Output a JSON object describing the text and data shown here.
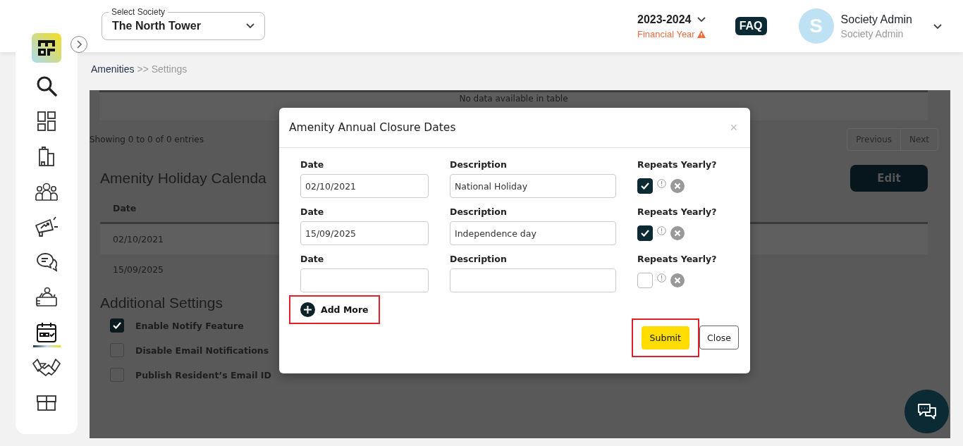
{
  "header": {
    "society_select": {
      "label": "Select Society",
      "value": "The North Tower"
    },
    "financial_year": {
      "value": "2023-2024",
      "label": "Financial Year"
    },
    "faq": "FAQ",
    "user": {
      "initial": "S",
      "name": "Society Admin",
      "role": "Society Admin"
    }
  },
  "sidebar": {
    "items": [
      {
        "kind": "search",
        "selected": false
      },
      {
        "kind": "dashboard",
        "selected": false
      },
      {
        "kind": "building",
        "selected": false
      },
      {
        "kind": "people",
        "selected": false
      },
      {
        "kind": "megaphone",
        "selected": false
      },
      {
        "kind": "chat",
        "selected": false
      },
      {
        "kind": "desk",
        "selected": false
      },
      {
        "kind": "calendar",
        "selected": true
      },
      {
        "kind": "handshake",
        "selected": false
      },
      {
        "kind": "box",
        "selected": false
      }
    ]
  },
  "breadcrumb": [
    {
      "label": "Amenities",
      "current": false
    },
    {
      "label": ">> Settings",
      "current": true
    }
  ],
  "closures_table": {
    "empty_text": "No data available in table",
    "info": "Showing 0 to 0 of 0 entries",
    "pagination": [
      "Previous",
      "Next"
    ]
  },
  "holiday_calendar": {
    "title": "Amenity Holiday Calenda",
    "edit_button": "Edit",
    "columns": [
      "Date"
    ],
    "rows": [
      "02/10/2021",
      "15/09/2025"
    ]
  },
  "additional_settings": {
    "title": "Additional Settings",
    "options": [
      {
        "label": "Enable Notify Feature",
        "checked": true
      },
      {
        "label": "Disable Email Notifications",
        "checked": false
      },
      {
        "label": "Publish Resident’s Email ID",
        "checked": false
      }
    ]
  },
  "modal": {
    "title": "Amenity Annual Closure Dates",
    "close_symbol": "×",
    "rows": [
      {
        "date_label": "Date",
        "date": "02/10/2021",
        "description_label": "Description",
        "description": "National Holiday",
        "repeats_label": "Repeats Yearly?",
        "repeats_yearly": true
      },
      {
        "date_label": "Date",
        "date": "15/09/2025",
        "description_label": "Description",
        "description": "Independence day",
        "repeats_label": "Repeats Yearly?",
        "repeats_yearly": true
      },
      {
        "date_label": "Date",
        "description_label": "Description",
        "repeats_label": "Repeats Yearly?",
        "repeats_yearly": false
      }
    ],
    "add_more": {
      "label": "Add More",
      "highlighted": true
    },
    "submit": {
      "label": "Submit",
      "highlighted": true
    },
    "close": {
      "label": "Close",
      "highlighted": false
    }
  }
}
